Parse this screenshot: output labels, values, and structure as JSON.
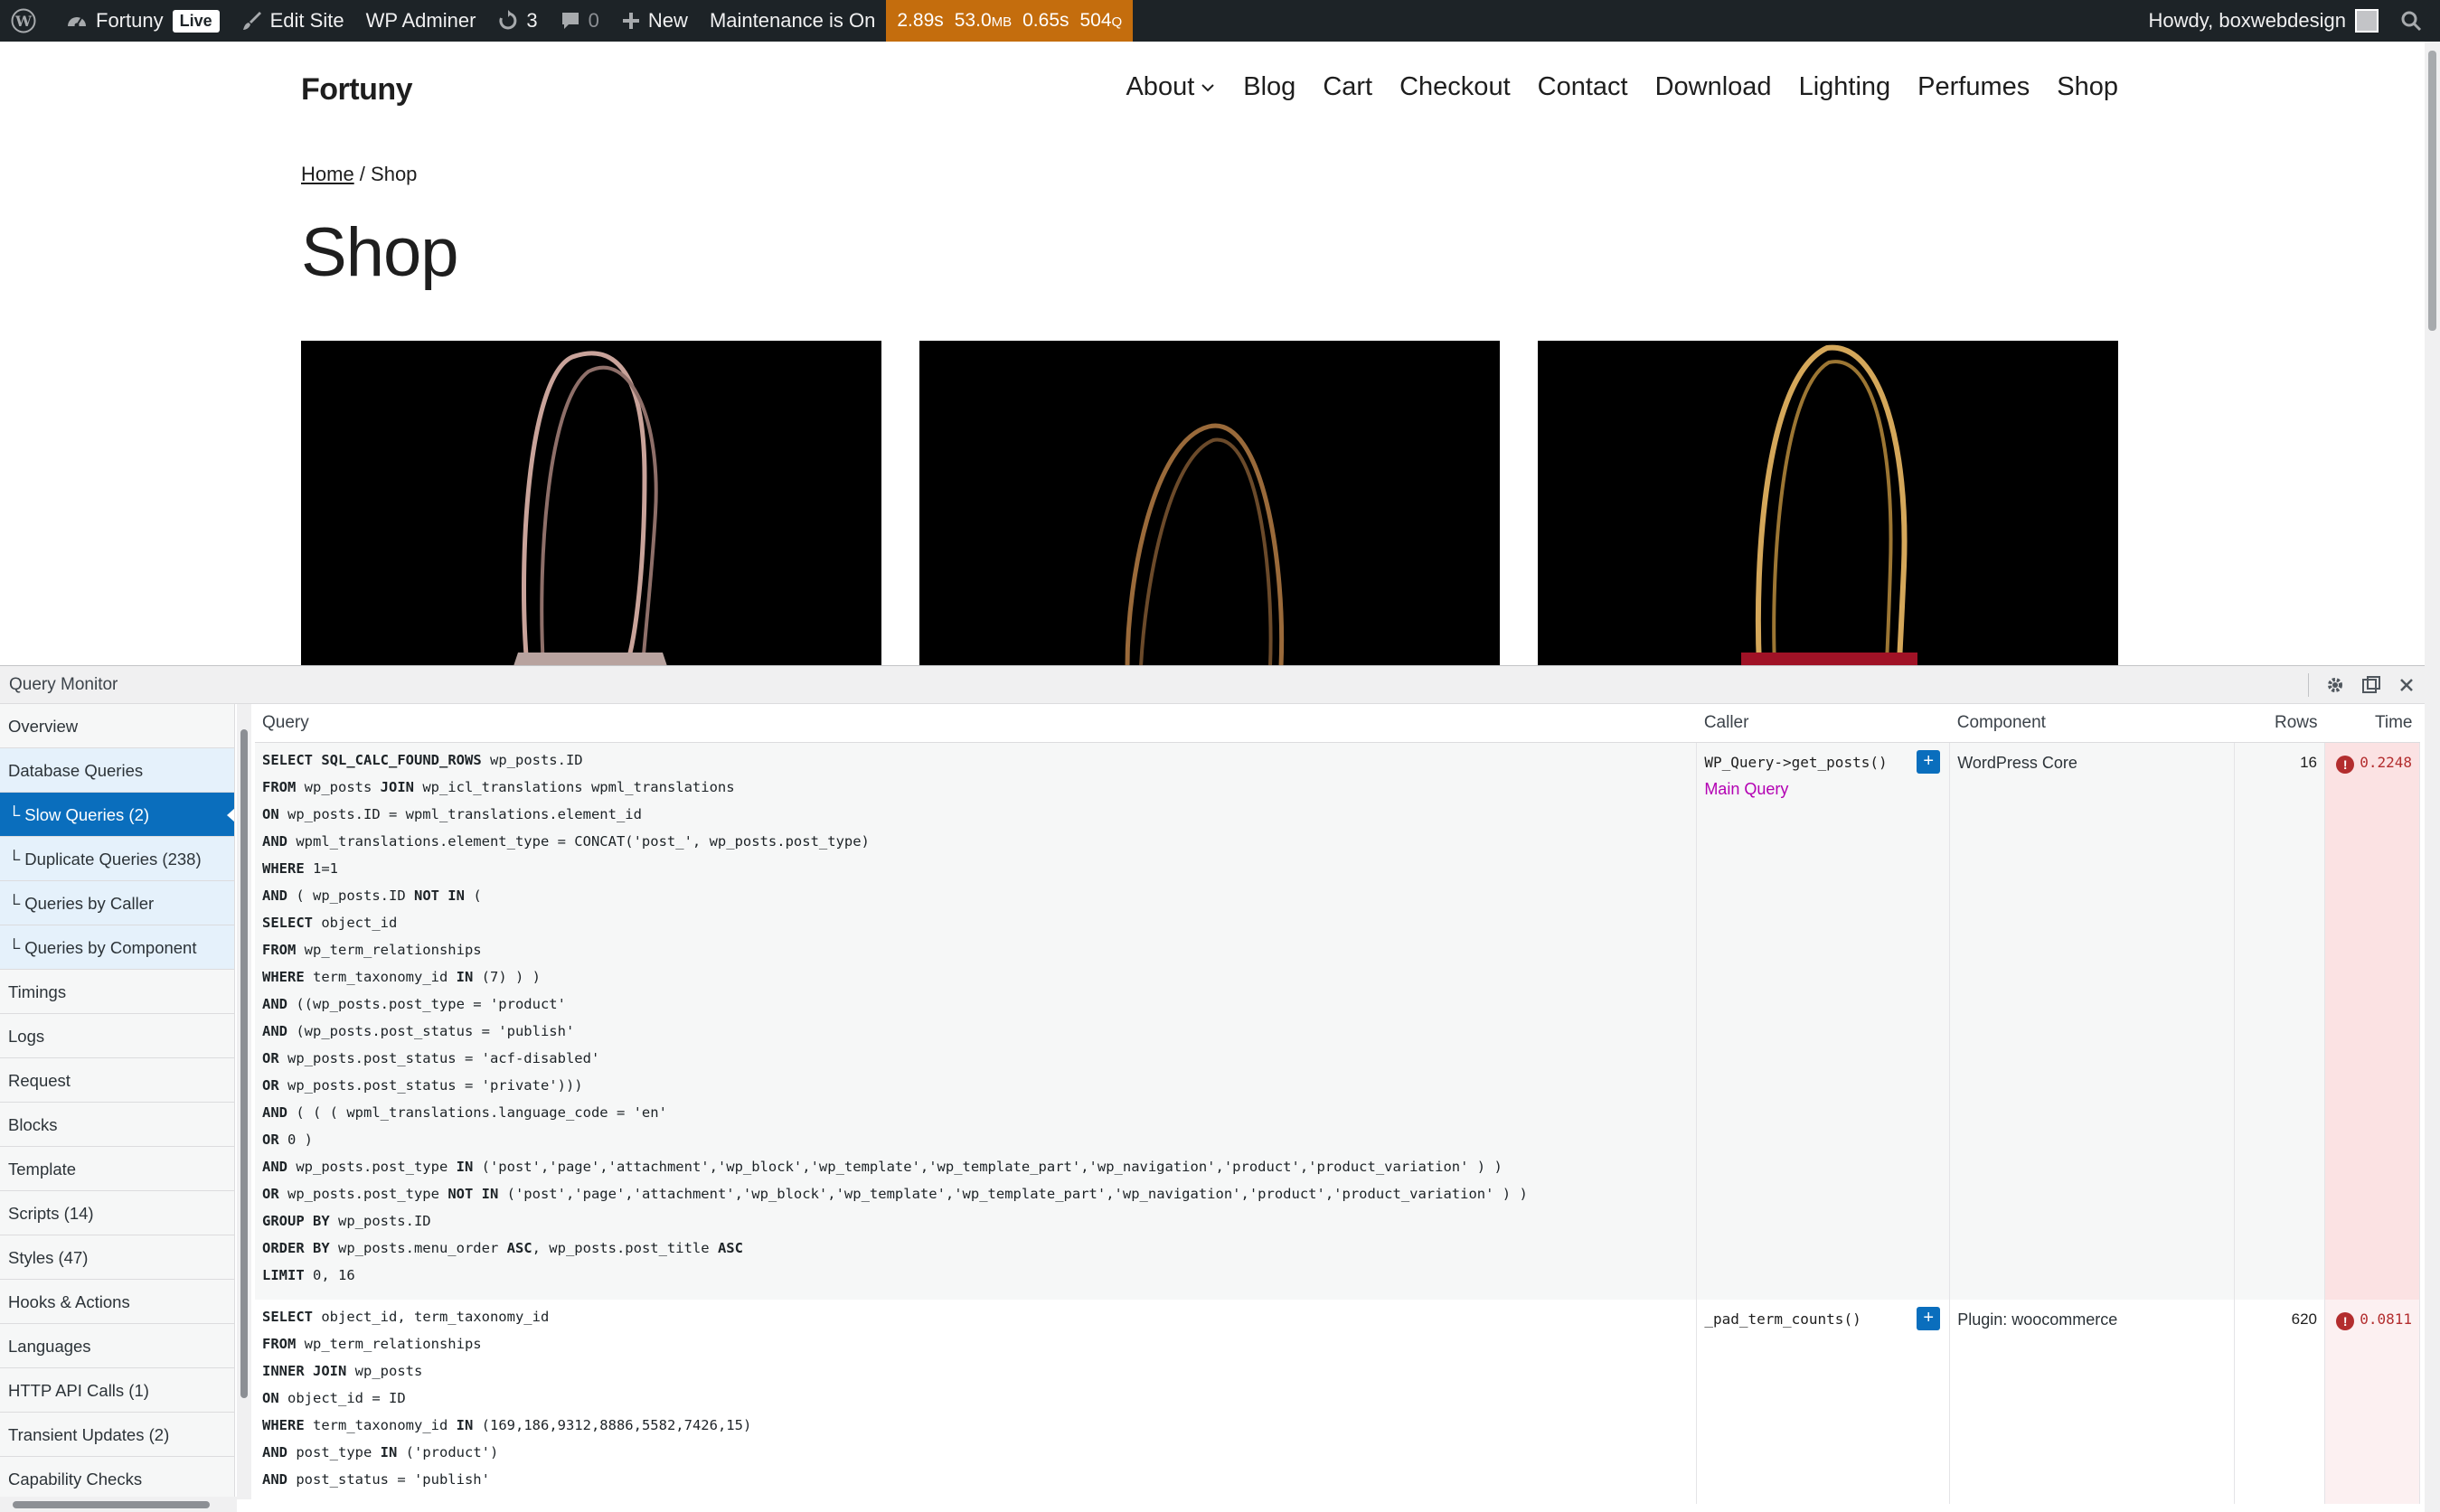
{
  "adminbar": {
    "site_name": "Fortuny",
    "live_badge": "Live",
    "edit_site": "Edit Site",
    "wp_adminer": "WP Adminer",
    "updates_count": "3",
    "comments_count": "0",
    "new_label": "New",
    "maintenance": "Maintenance is On",
    "qm_time": "2.89s",
    "qm_memory": "53.0",
    "qm_memory_unit": "MB",
    "qm_db_time": "0.65s",
    "qm_queries": "504",
    "qm_queries_unit": "Q",
    "howdy": "Howdy, boxwebdesign"
  },
  "site": {
    "title": "Fortuny",
    "nav": [
      "About",
      "Blog",
      "Cart",
      "Checkout",
      "Contact",
      "Download",
      "Lighting",
      "Perfumes",
      "Shop"
    ]
  },
  "breadcrumb": {
    "home": "Home",
    "separator": " / ",
    "current": "Shop"
  },
  "page_title": "Shop",
  "qm": {
    "title": "Query Monitor",
    "menu": [
      {
        "label": "Overview",
        "type": "top"
      },
      {
        "label": "Database Queries",
        "type": "db"
      },
      {
        "label": "└ Slow Queries (2)",
        "type": "active"
      },
      {
        "label": "└ Duplicate Queries (238)",
        "type": "sub"
      },
      {
        "label": "└ Queries by Caller",
        "type": "sub"
      },
      {
        "label": "└ Queries by Component",
        "type": "sub"
      },
      {
        "label": "Timings",
        "type": "top"
      },
      {
        "label": "Logs",
        "type": "top"
      },
      {
        "label": "Request",
        "type": "top"
      },
      {
        "label": "Blocks",
        "type": "top"
      },
      {
        "label": "Template",
        "type": "top"
      },
      {
        "label": "Scripts (14)",
        "type": "top"
      },
      {
        "label": "Styles (47)",
        "type": "top"
      },
      {
        "label": "Hooks & Actions",
        "type": "top"
      },
      {
        "label": "Languages",
        "type": "top"
      },
      {
        "label": "HTTP API Calls (1)",
        "type": "top"
      },
      {
        "label": "Transient Updates (2)",
        "type": "top"
      },
      {
        "label": "Capability Checks",
        "type": "top"
      }
    ],
    "columns": {
      "query": "Query",
      "caller": "Caller",
      "component": "Component",
      "rows": "Rows",
      "time": "Time"
    },
    "rows": [
      {
        "sql": [
          "SELECT SQL_CALC_FOUND_ROWS wp_posts.ID",
          "FROM wp_posts JOIN wp_icl_translations wpml_translations",
          "ON wp_posts.ID = wpml_translations.element_id",
          "AND wpml_translations.element_type = CONCAT('post_', wp_posts.post_type)",
          "WHERE 1=1",
          "AND ( wp_posts.ID NOT IN (",
          "SELECT object_id",
          "FROM wp_term_relationships",
          "WHERE term_taxonomy_id IN (7) ) )",
          "AND ((wp_posts.post_type = 'product'",
          "AND (wp_posts.post_status = 'publish'",
          "OR wp_posts.post_status = 'acf-disabled'",
          "OR wp_posts.post_status = 'private')))",
          "AND ( ( ( wpml_translations.language_code = 'en'",
          "OR 0 )",
          "AND wp_posts.post_type IN ('post','page','attachment','wp_block','wp_template','wp_template_part','wp_navigation','product','product_variation' ) )",
          "OR wp_posts.post_type NOT IN ('post','page','attachment','wp_block','wp_template','wp_template_part','wp_navigation','product','product_variation' ) )",
          "GROUP BY wp_posts.ID",
          "ORDER BY wp_posts.menu_order ASC, wp_posts.post_title ASC",
          "LIMIT 0, 16"
        ],
        "caller": "WP_Query->get_posts()",
        "caller_note": "Main Query",
        "component": "WordPress Core",
        "rows": "16",
        "time": "0.2248"
      },
      {
        "sql": [
          "SELECT object_id, term_taxonomy_id",
          "FROM wp_term_relationships",
          "INNER JOIN wp_posts",
          "ON object_id = ID",
          "WHERE term_taxonomy_id IN (169,186,9312,8886,5582,7426,15)",
          "AND post_type IN ('product')",
          "AND post_status = 'publish'"
        ],
        "caller": "_pad_term_counts()",
        "caller_note": "",
        "component": "Plugin: woocommerce",
        "rows": "620",
        "time": "0.0811"
      }
    ]
  }
}
